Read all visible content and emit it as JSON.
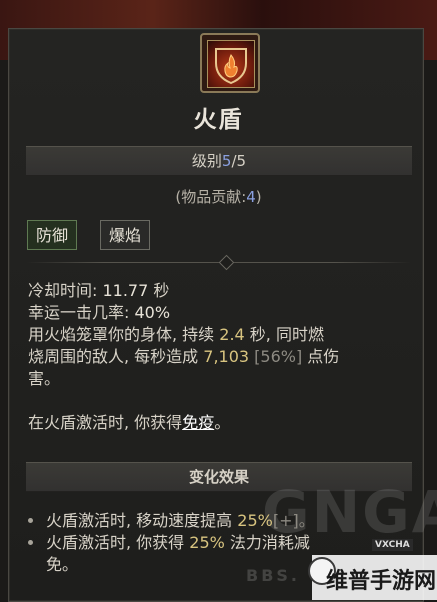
{
  "skill": {
    "name": "火盾",
    "rank_label": "级别",
    "rank_current": "5",
    "rank_sep": "/",
    "rank_max": "5",
    "item_contrib_prefix": "(物品贡献:",
    "item_contrib_value": "4",
    "item_contrib_suffix": ")",
    "tags": [
      "防御",
      "爆焰"
    ],
    "icon": "fire-shield-icon"
  },
  "stats": {
    "cooldown_label": "冷却时间: ",
    "cooldown_value": "11.77",
    "cooldown_unit": " 秒",
    "lucky_label": "幸运一击几率: ",
    "lucky_value": "40%",
    "desc_1a": "用火焰笼罩你的身体, 持续 ",
    "desc_1_duration": "2.4",
    "desc_1b": " 秒, 同时燃",
    "desc_2a": "烧周围的敌人, 每秒造成 ",
    "desc_2_damage": "7,103",
    "desc_2_pct": " [56%] ",
    "desc_2b": "点伤",
    "desc_3": "害。",
    "desc_4a": "在火盾激活时, 你获得",
    "desc_4_keyword": "免疫",
    "desc_4b": "。"
  },
  "effects": {
    "header": "变化效果",
    "row1_a": "火盾激活时, 移动速度提高 ",
    "row1_value": "25%",
    "row1_b": "[+]。",
    "row2_a": "火盾激活时, 你获得 ",
    "row2_value": "25%",
    "row2_b": " 法力消耗减",
    "row3": "免。"
  },
  "watermarks": {
    "big": "GNGA",
    "vxcha": "VXCHA",
    "bbs": "BBS.",
    "site": "维普手游网"
  },
  "colors": {
    "rank_accent": "#8aa0e0",
    "highlight": "#d8c480",
    "active_tag_border": "#5f7a52"
  }
}
